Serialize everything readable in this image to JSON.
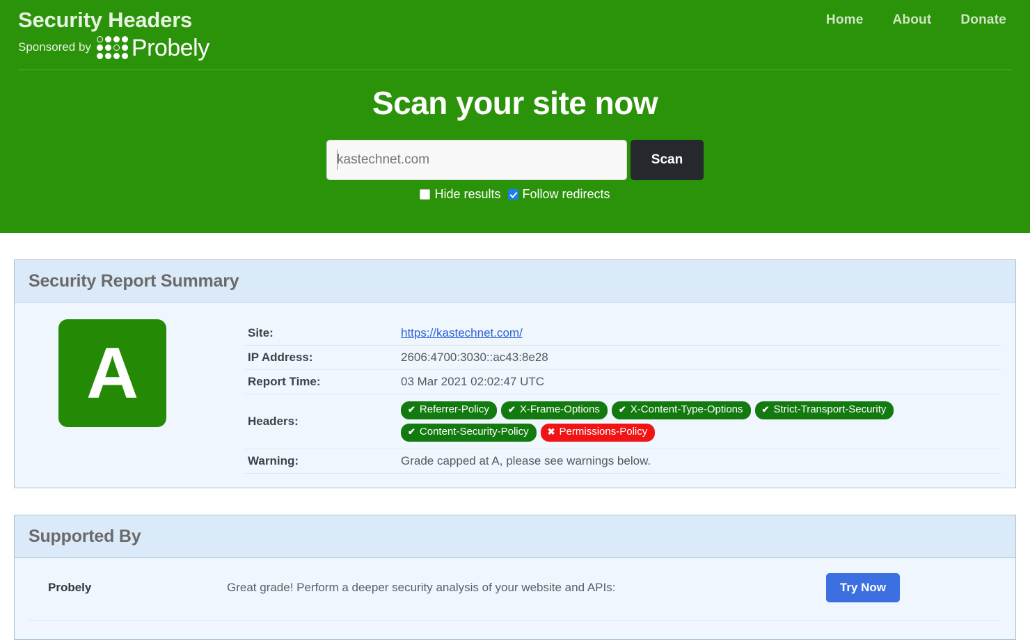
{
  "site": {
    "brand_title": "Security Headers",
    "sponsored_label": "Sponsored by",
    "sponsor_name": "Probely"
  },
  "nav": {
    "items": [
      {
        "label": "Home"
      },
      {
        "label": "About"
      },
      {
        "label": "Donate"
      }
    ]
  },
  "hero": {
    "heading": "Scan your site now",
    "search": {
      "placeholder": "kastechnet.com",
      "value": "",
      "button_label": "Scan"
    },
    "options": [
      {
        "label": "Hide results",
        "checked": false
      },
      {
        "label": "Follow redirects",
        "checked": true
      }
    ]
  },
  "report": {
    "card_title": "Security Report Summary",
    "grade": "A",
    "rows": {
      "site_label": "Site:",
      "site_value": "https://kastechnet.com/",
      "ip_label": "IP Address:",
      "ip_value": "2606:4700:3030::ac43:8e28",
      "time_label": "Report Time:",
      "time_value": "03 Mar 2021 02:02:47 UTC",
      "headers_label": "Headers:",
      "warning_label": "Warning:",
      "warning_value": "Grade capped at A, please see warnings below."
    },
    "headers": [
      {
        "name": "Referrer-Policy",
        "status": "ok",
        "mark": "✔"
      },
      {
        "name": "X-Frame-Options",
        "status": "ok",
        "mark": "✔"
      },
      {
        "name": "X-Content-Type-Options",
        "status": "ok",
        "mark": "✔"
      },
      {
        "name": "Strict-Transport-Security",
        "status": "ok",
        "mark": "✔"
      },
      {
        "name": "Content-Security-Policy",
        "status": "ok",
        "mark": "✔"
      },
      {
        "name": "Permissions-Policy",
        "status": "bad",
        "mark": "✖"
      }
    ]
  },
  "supported": {
    "card_title": "Supported By",
    "sponsor_name": "Probely",
    "description": "Great grade! Perform a deeper security analysis of your website and APIs:",
    "cta_label": "Try Now"
  },
  "colors": {
    "brand_green": "#2b9309",
    "grade_green": "#248a06",
    "badge_ok": "#137a10",
    "badge_bad": "#f01414",
    "cta_blue": "#3c6fe0",
    "checkbox_blue": "#1a7ef0",
    "scan_dark": "#25282c",
    "card_header_blue": "#dbeaf8",
    "card_body_blue": "#eff6fd"
  }
}
